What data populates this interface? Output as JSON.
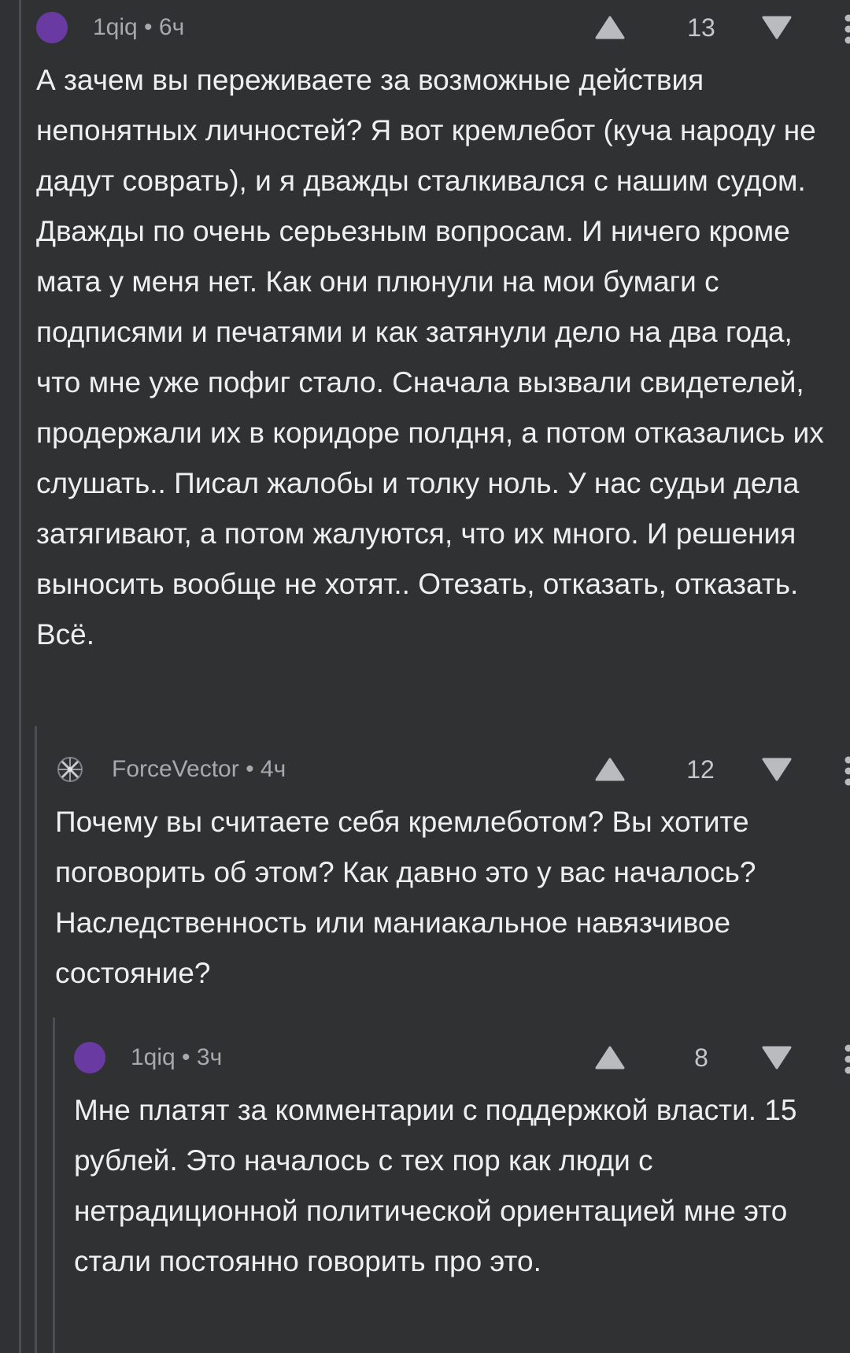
{
  "comments": [
    {
      "author": "1qiq",
      "time": "6ч",
      "score": "13",
      "avatar": {
        "type": "dot",
        "color": "#6a3aa3"
      },
      "text": "А зачем вы переживаете за возможные действия непонятных личностей? Я вот кремлебот (куча народу не дадут соврать), и я дважды сталкивался с нашим судом. Дважды по очень серьезным вопросам. И ничего кроме мата у меня нет. Как они плюнули на мои бумаги с подписями и печатями и как затянули дело на два года, что мне уже пофиг стало. Сначала вызвали свидетелей, продержали их в коридоре полдня, а потом отказались их слушать.. Писал жалобы и толку ноль. У нас судьи дела затягивают, а потом жалуются, что их много. И решения выносить вообще не хотят.. Отезать, отказать, отказать. Всё."
    },
    {
      "author": "ForceVector",
      "time": "4ч",
      "score": "12",
      "avatar": {
        "type": "logo",
        "icon": "compass-star-icon"
      },
      "text": "Почему вы считаете себя кремлеботом? Вы хотите поговорить об этом? Как давно это у вас началось? Наследственность или маниакальное навязчивое состояние?"
    },
    {
      "author": "1qiq",
      "time": "3ч",
      "score": "8",
      "avatar": {
        "type": "dot",
        "color": "#6a3aa3"
      },
      "text": "Мне платят за комментарии с поддержкой власти. 15 рублей. Это началось с тех пор как люди с нетрадиционной политической ориентацией мне это стали постоянно говорить про это."
    }
  ],
  "separator": " • ",
  "icons": {
    "upvote": "triangle-up-icon",
    "downvote": "triangle-down-icon",
    "more": "vertical-dots-icon"
  },
  "colors": {
    "background": "#303133",
    "thread_line": "#4b4d51",
    "meta_text": "#a7a9ad",
    "body_text": "#efefef",
    "icon": "#b9bbbf"
  }
}
